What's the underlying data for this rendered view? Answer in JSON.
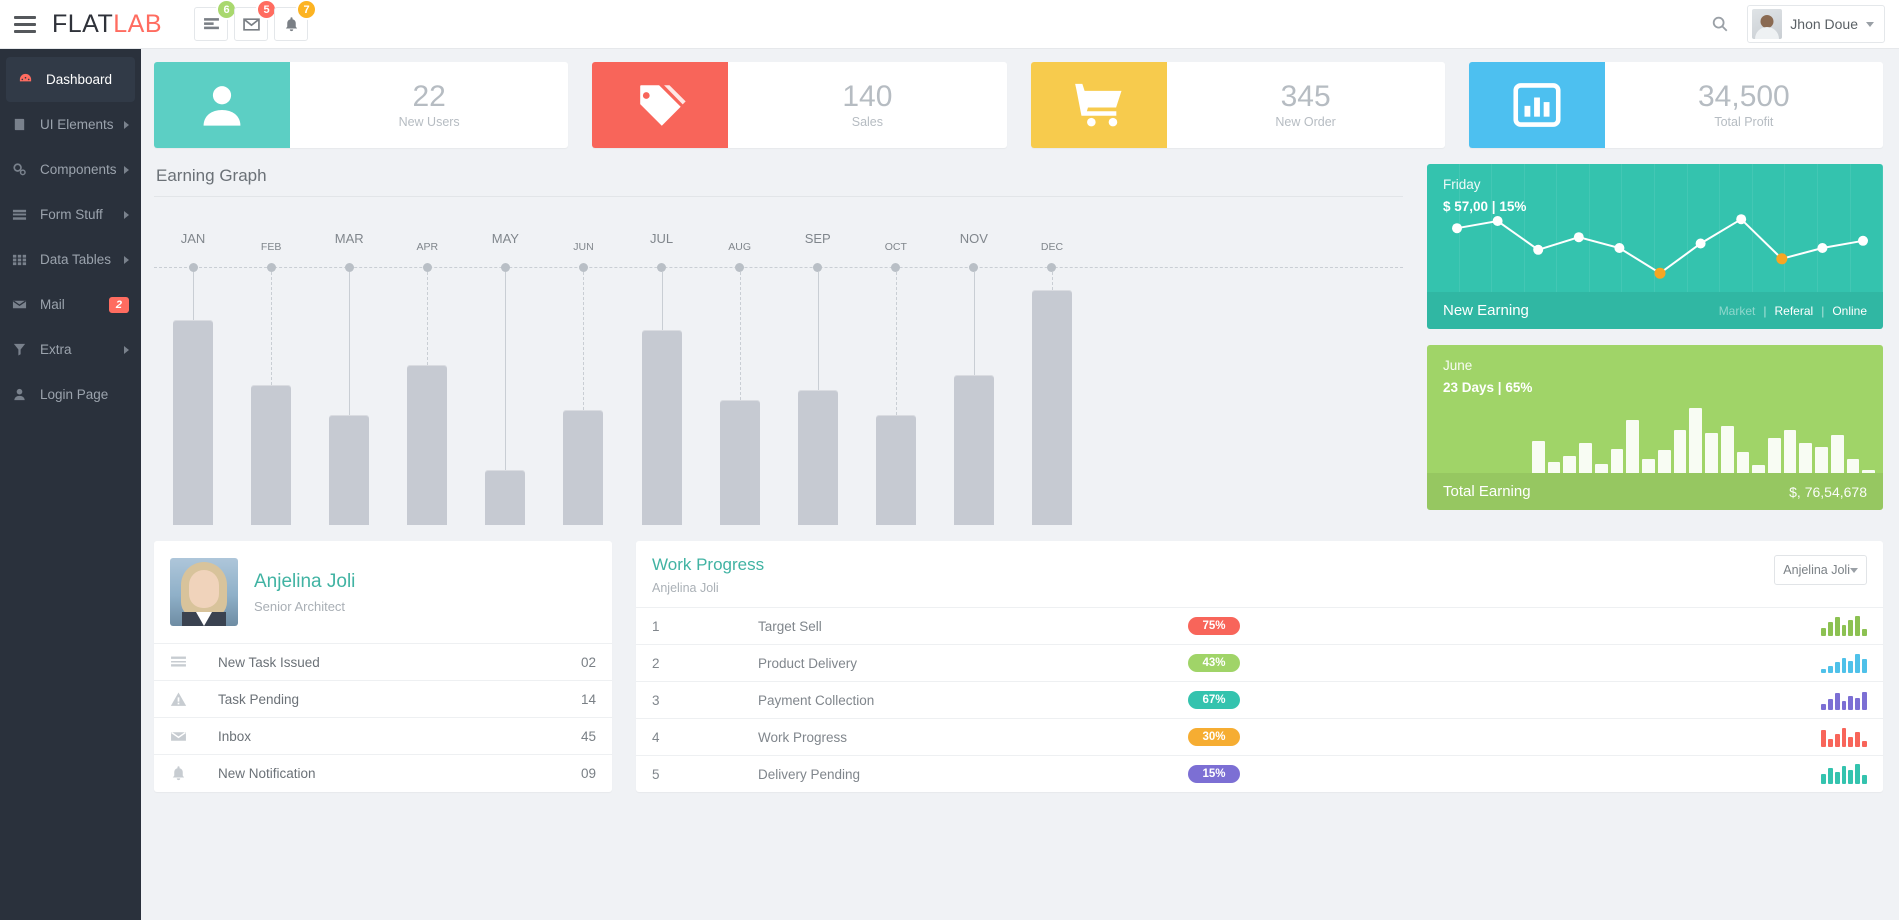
{
  "header": {
    "brand_first": "FLAT",
    "brand_second": "LAB",
    "menu_icon": "hamburger-icon",
    "icons": [
      {
        "name": "tasks-icon",
        "badge": "6",
        "badge_color": "#a9d86e"
      },
      {
        "name": "envelope-icon",
        "badge": "5",
        "badge_color": "#ff6c60"
      },
      {
        "name": "bell-icon",
        "badge": "7",
        "badge_color": "#fcb322"
      }
    ],
    "search_icon": "search-icon",
    "user": "Jhon Doue"
  },
  "sidebar": {
    "items": [
      {
        "label": "Dashboard",
        "icon": "dashboard-icon",
        "active": true,
        "arrow": false,
        "badge": null
      },
      {
        "label": "UI Elements",
        "icon": "book-icon",
        "active": false,
        "arrow": true,
        "badge": null
      },
      {
        "label": "Components",
        "icon": "gears-icon",
        "active": false,
        "arrow": true,
        "badge": null
      },
      {
        "label": "Form Stuff",
        "icon": "form-icon",
        "active": false,
        "arrow": true,
        "badge": null
      },
      {
        "label": "Data Tables",
        "icon": "grid-icon",
        "active": false,
        "arrow": true,
        "badge": null
      },
      {
        "label": "Mail",
        "icon": "envelope-icon",
        "active": false,
        "arrow": false,
        "badge": "2"
      },
      {
        "label": "Extra",
        "icon": "funnel-icon",
        "active": false,
        "arrow": true,
        "badge": null
      },
      {
        "label": "Login Page",
        "icon": "user-icon",
        "active": false,
        "arrow": false,
        "badge": null
      }
    ]
  },
  "stats": [
    {
      "value": "22",
      "label": "New Users",
      "color": "#5ccfc4",
      "icon": "user-icon"
    },
    {
      "value": "140",
      "label": "Sales",
      "color": "#f8655a",
      "icon": "tag-icon"
    },
    {
      "value": "345",
      "label": "New Order",
      "color": "#f7cb4d",
      "icon": "cart-icon"
    },
    {
      "value": "34,500",
      "label": "Total Profit",
      "color": "#4dc0f0",
      "icon": "bar-chart-icon"
    }
  ],
  "earning_graph": {
    "title": "Earning Graph"
  },
  "chart_data": {
    "type": "bar",
    "title": "Earning Graph",
    "categories": [
      "JAN",
      "FEB",
      "MAR",
      "APR",
      "MAY",
      "JUN",
      "JUL",
      "AUG",
      "SEP",
      "OCT",
      "NOV",
      "DEC"
    ],
    "values": [
      205,
      140,
      110,
      160,
      55,
      115,
      195,
      125,
      135,
      110,
      150,
      235
    ],
    "label_sizes": [
      "lg",
      "sm",
      "lg",
      "sm",
      "lg",
      "sm",
      "lg",
      "sm",
      "lg",
      "sm",
      "lg",
      "sm"
    ],
    "xlabel": "",
    "ylabel": "",
    "ylim": [
      0,
      260
    ],
    "grid": false,
    "legend": "none"
  },
  "new_earning": {
    "day": "Friday",
    "stat": "$ 57,00 | 15%",
    "footer": "New Earning",
    "legend": [
      "Market",
      "Referal",
      "Online"
    ],
    "accent": "#34c3ae",
    "line_points": [
      62,
      70,
      38,
      52,
      40,
      12,
      45,
      72,
      28,
      40,
      48
    ],
    "highlight_indices": [
      5,
      8
    ]
  },
  "total_earning": {
    "month": "June",
    "stat": "23 Days | 65%",
    "footer": "Total Earning",
    "amount": "$, 76,54,678",
    "accent": "#a0d468",
    "bars": [
      42,
      14,
      22,
      40,
      12,
      32,
      70,
      18,
      30,
      56,
      86,
      52,
      62,
      28,
      10,
      46,
      56,
      40,
      34,
      50,
      18,
      4
    ]
  },
  "profile": {
    "name": "Anjelina Joli",
    "role": "Senior Architect",
    "rows": [
      {
        "label": "New Task Issued",
        "value": "02",
        "icon": "tasks-icon"
      },
      {
        "label": "Task Pending",
        "value": "14",
        "icon": "warning-icon"
      },
      {
        "label": "Inbox",
        "value": "45",
        "icon": "envelope-icon"
      },
      {
        "label": "New Notification",
        "value": "09",
        "icon": "bell-icon"
      }
    ]
  },
  "work_progress": {
    "title": "Work Progress",
    "subtitle": "Anjelina Joli",
    "select_value": "Anjelina Joli",
    "rows": [
      {
        "index": "1",
        "task": "Target Sell",
        "percent": "75%",
        "color": "#f8655a",
        "spark_color": "#8cc152",
        "spark": [
          40,
          70,
          95,
          55,
          80,
          100,
          35
        ]
      },
      {
        "index": "2",
        "task": "Product Delivery",
        "percent": "43%",
        "color": "#a0d468",
        "spark_color": "#4fc1e9",
        "spark": [
          20,
          35,
          55,
          75,
          60,
          95,
          70
        ]
      },
      {
        "index": "3",
        "task": "Payment Collection",
        "percent": "67%",
        "color": "#34c3ae",
        "spark_color": "#7c6fd4",
        "spark": [
          30,
          55,
          85,
          45,
          70,
          60,
          90
        ]
      },
      {
        "index": "4",
        "task": "Work Progress",
        "percent": "30%",
        "color": "#f6ad32",
        "spark_color": "#f8655a",
        "spark": [
          85,
          40,
          65,
          95,
          50,
          75,
          30
        ]
      },
      {
        "index": "5",
        "task": "Delivery Pending",
        "percent": "15%",
        "color": "#7c6fd4",
        "spark_color": "#34c3ae",
        "spark": [
          50,
          80,
          60,
          90,
          70,
          100,
          45
        ]
      }
    ]
  }
}
